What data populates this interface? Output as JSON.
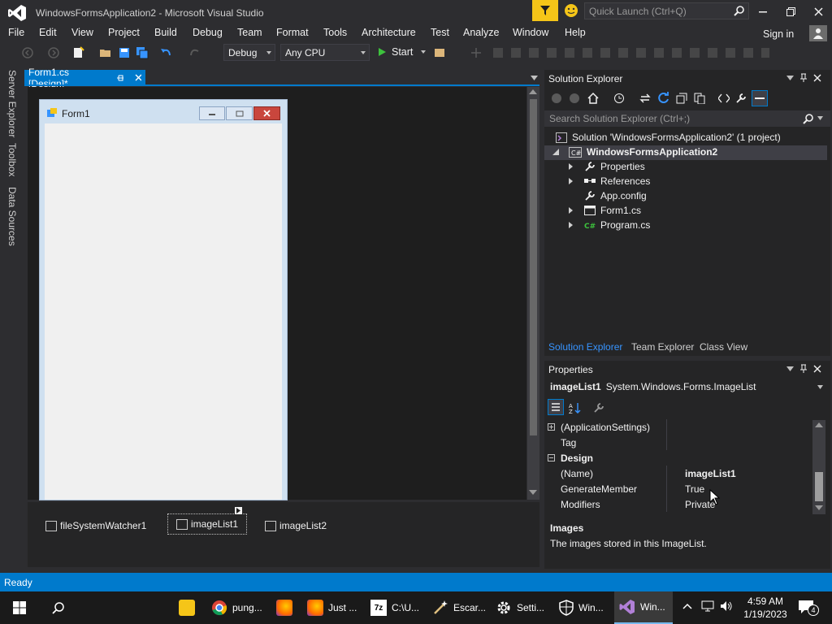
{
  "window": {
    "title": "WindowsFormsApplication2 - Microsoft Visual Studio",
    "quick_launch_placeholder": "Quick Launch (Ctrl+Q)"
  },
  "menu": [
    "File",
    "Edit",
    "View",
    "Project",
    "Build",
    "Debug",
    "Team",
    "Format",
    "Tools",
    "Architecture",
    "Test",
    "Analyze",
    "Window",
    "Help"
  ],
  "signin_label": "Sign in",
  "toolbar": {
    "config": "Debug",
    "platform": "Any CPU",
    "start_label": "Start"
  },
  "side_tabs": [
    "Server Explorer",
    "Toolbox",
    "Data Sources"
  ],
  "document_tab": "Form1.cs [Design]*",
  "form": {
    "title": "Form1"
  },
  "tray_items": [
    "fileSystemWatcher1",
    "imageList1",
    "imageList2"
  ],
  "solution_explorer": {
    "title": "Solution Explorer",
    "search_placeholder": "Search Solution Explorer (Ctrl+;)",
    "solution": "Solution 'WindowsFormsApplication2' (1 project)",
    "project": "WindowsFormsApplication2",
    "items": [
      "Properties",
      "References",
      "App.config",
      "Form1.cs",
      "Program.cs"
    ],
    "tabs": [
      "Solution Explorer",
      "Team Explorer",
      "Class View"
    ]
  },
  "properties": {
    "title": "Properties",
    "object_name": "imageList1",
    "object_type": "System.Windows.Forms.ImageList",
    "rows": [
      {
        "name": "(ApplicationSettings)",
        "value": ""
      },
      {
        "name": "Tag",
        "value": ""
      },
      {
        "name": "Design",
        "value": ""
      },
      {
        "name": "(Name)",
        "value": "imageList1"
      },
      {
        "name": "GenerateMember",
        "value": "True"
      },
      {
        "name": "Modifiers",
        "value": "Private"
      }
    ],
    "desc_title": "Images",
    "desc_text": "The images stored in this ImageList."
  },
  "status": "Ready",
  "taskbar": {
    "apps": [
      "pung...",
      "Just ...",
      "C:\\U...",
      "Escar...",
      "Setti...",
      "Win...",
      "Win..."
    ],
    "time": "4:59 AM",
    "date": "1/19/2023",
    "notifications": "4"
  },
  "colors": {
    "accent": "#007acc",
    "background": "#2d2d30",
    "feedback": "#f5c518"
  }
}
